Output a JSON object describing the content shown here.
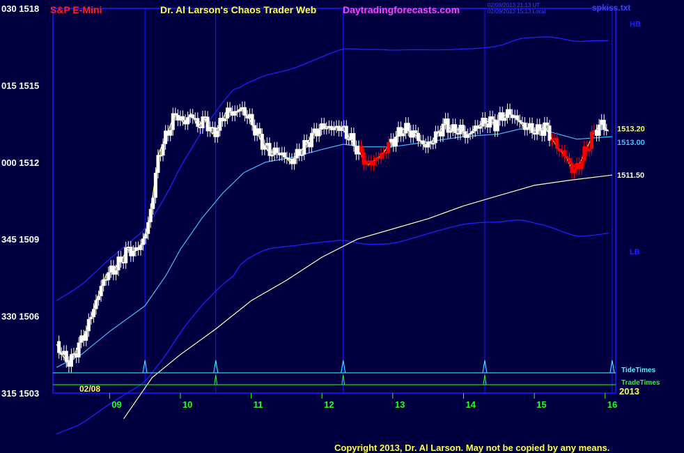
{
  "header": {
    "symbol": "S&P E-Mini",
    "author": "Dr. Al Larson's Chaos Trader Web",
    "site": "Daytradingforecasts.com",
    "utc_stamp": "02/09/2013 21:13 UT",
    "local_stamp": "02/09/2013 15:13 Local",
    "file": "spkiss.txt"
  },
  "footer": {
    "copyright": "Copyright 2013, Dr. Al Larson. May not be copied by any means."
  },
  "colors": {
    "background": "#000040",
    "frame": "#1a1aff",
    "bull_candle": "#ffffff",
    "bear_candle": "#ff0000",
    "ema_short": "#ffff40",
    "ema_mid": "#40c0ff",
    "ma_long": "#ffffc0",
    "bands": "#2020ff",
    "tide": "#40ffff",
    "trade": "#20ff20",
    "ylabel": "#ffffff",
    "xlabel": "#20ff20",
    "time_lines": "#1a1aff"
  },
  "chart_data": {
    "type": "candlestick",
    "y_ticks": [
      {
        "value": 1518,
        "label": "030  1518"
      },
      {
        "value": 1515,
        "label": "015  1515"
      },
      {
        "value": 1512,
        "label": "000  1512"
      },
      {
        "value": 1509,
        "label": "345  1509"
      },
      {
        "value": 1506,
        "label": "330  1506"
      },
      {
        "value": 1503,
        "label": "315  1503"
      }
    ],
    "ylim": [
      1503,
      1518
    ],
    "xlim": [
      8.2,
      16.15
    ],
    "x_ticks": [
      {
        "value": 9,
        "label": "09"
      },
      {
        "value": 10,
        "label": "10"
      },
      {
        "value": 11,
        "label": "11"
      },
      {
        "value": 12,
        "label": "12"
      },
      {
        "value": 13,
        "label": "13"
      },
      {
        "value": 14,
        "label": "14"
      },
      {
        "value": 15,
        "label": "15"
      },
      {
        "value": 16,
        "label": "16"
      }
    ],
    "date_label": "02/08",
    "year_label": "2013",
    "time_lines": [
      9.5,
      10.5,
      12.3,
      14.3,
      16.1
    ],
    "tide_times": [
      9.5,
      10.5,
      12.3,
      14.3,
      16.1
    ],
    "trade_times": [
      10.5,
      12.3,
      14.3
    ],
    "band_labels": {
      "upper": "HB",
      "lower": "LB"
    },
    "level_labels": [
      {
        "value": 1513.2,
        "label": "1513.20",
        "color": "#ffff40"
      },
      {
        "value": 1513.0,
        "label": "1513.00",
        "color": "#40c0ff"
      },
      {
        "value": 1511.5,
        "label": "1511.50",
        "color": "#ffffff"
      }
    ],
    "row_labels": {
      "tide": "TideTimes",
      "trade": "TradeTimes"
    },
    "price_path": [
      [
        8.25,
        1504.9
      ],
      [
        8.35,
        1504.4
      ],
      [
        8.45,
        1504.2
      ],
      [
        8.55,
        1504.8
      ],
      [
        8.65,
        1505.3
      ],
      [
        8.75,
        1506.1
      ],
      [
        8.85,
        1506.9
      ],
      [
        8.95,
        1507.6
      ],
      [
        9.05,
        1507.8
      ],
      [
        9.15,
        1508.1
      ],
      [
        9.25,
        1508.6
      ],
      [
        9.35,
        1508.5
      ],
      [
        9.45,
        1508.8
      ],
      [
        9.55,
        1509.6
      ],
      [
        9.62,
        1510.9
      ],
      [
        9.7,
        1512.4
      ],
      [
        9.8,
        1513.0
      ],
      [
        9.88,
        1513.6
      ],
      [
        9.95,
        1513.9
      ],
      [
        10.05,
        1513.5
      ],
      [
        10.15,
        1513.9
      ],
      [
        10.25,
        1513.4
      ],
      [
        10.35,
        1513.7
      ],
      [
        10.45,
        1513.1
      ],
      [
        10.55,
        1513.4
      ],
      [
        10.65,
        1514.0
      ],
      [
        10.75,
        1513.9
      ],
      [
        10.85,
        1514.1
      ],
      [
        10.95,
        1513.8
      ],
      [
        11.05,
        1513.3
      ],
      [
        11.15,
        1512.8
      ],
      [
        11.25,
        1512.4
      ],
      [
        11.35,
        1512.4
      ],
      [
        11.45,
        1512.3
      ],
      [
        11.55,
        1512.0
      ],
      [
        11.65,
        1512.3
      ],
      [
        11.75,
        1512.6
      ],
      [
        11.85,
        1513.0
      ],
      [
        11.95,
        1513.3
      ],
      [
        12.05,
        1513.4
      ],
      [
        12.15,
        1513.3
      ],
      [
        12.25,
        1513.4
      ],
      [
        12.35,
        1513.1
      ],
      [
        12.45,
        1512.7
      ],
      [
        12.55,
        1512.3
      ],
      [
        12.65,
        1511.9
      ],
      [
        12.75,
        1512.1
      ],
      [
        12.85,
        1512.3
      ],
      [
        12.95,
        1512.7
      ],
      [
        13.05,
        1513.0
      ],
      [
        13.15,
        1513.3
      ],
      [
        13.25,
        1513.2
      ],
      [
        13.35,
        1513.0
      ],
      [
        13.45,
        1512.6
      ],
      [
        13.55,
        1512.8
      ],
      [
        13.65,
        1513.2
      ],
      [
        13.75,
        1513.5
      ],
      [
        13.85,
        1513.2
      ],
      [
        13.95,
        1513.3
      ],
      [
        14.05,
        1513.0
      ],
      [
        14.15,
        1513.3
      ],
      [
        14.25,
        1513.5
      ],
      [
        14.35,
        1513.6
      ],
      [
        14.45,
        1513.5
      ],
      [
        14.55,
        1513.8
      ],
      [
        14.65,
        1513.9
      ],
      [
        14.75,
        1513.7
      ],
      [
        14.85,
        1513.4
      ],
      [
        14.95,
        1513.3
      ],
      [
        15.05,
        1513.2
      ],
      [
        15.15,
        1513.4
      ],
      [
        15.25,
        1512.9
      ],
      [
        15.35,
        1512.5
      ],
      [
        15.45,
        1512.2
      ],
      [
        15.55,
        1511.6
      ],
      [
        15.65,
        1512.0
      ],
      [
        15.75,
        1512.6
      ],
      [
        15.85,
        1513.2
      ],
      [
        15.95,
        1513.5
      ],
      [
        16.05,
        1513.2
      ]
    ],
    "ma_long_path": [
      [
        9.2,
        1502.0
      ],
      [
        9.6,
        1503.6
      ],
      [
        10,
        1504.5
      ],
      [
        10.5,
        1505.5
      ],
      [
        11,
        1506.6
      ],
      [
        11.5,
        1507.4
      ],
      [
        12,
        1508.3
      ],
      [
        12.5,
        1509.0
      ],
      [
        13,
        1509.4
      ],
      [
        13.5,
        1509.8
      ],
      [
        14,
        1510.3
      ],
      [
        14.5,
        1510.7
      ],
      [
        15,
        1511.1
      ],
      [
        15.5,
        1511.3
      ],
      [
        16.1,
        1511.5
      ]
    ],
    "ema_mid_path": [
      [
        8.25,
        1504.0
      ],
      [
        8.6,
        1504.5
      ],
      [
        9,
        1505.4
      ],
      [
        9.5,
        1506.4
      ],
      [
        9.8,
        1507.6
      ],
      [
        10,
        1508.6
      ],
      [
        10.3,
        1509.8
      ],
      [
        10.6,
        1510.8
      ],
      [
        10.9,
        1511.6
      ],
      [
        11.2,
        1512.0
      ],
      [
        11.6,
        1512.2
      ],
      [
        12,
        1512.5
      ],
      [
        12.3,
        1512.7
      ],
      [
        12.6,
        1512.6
      ],
      [
        13,
        1512.6
      ],
      [
        13.5,
        1512.8
      ],
      [
        14,
        1513.0
      ],
      [
        14.5,
        1513.1
      ],
      [
        14.8,
        1513.3
      ],
      [
        15.2,
        1513.2
      ],
      [
        15.6,
        1512.9
      ],
      [
        16.1,
        1513.0
      ]
    ]
  }
}
